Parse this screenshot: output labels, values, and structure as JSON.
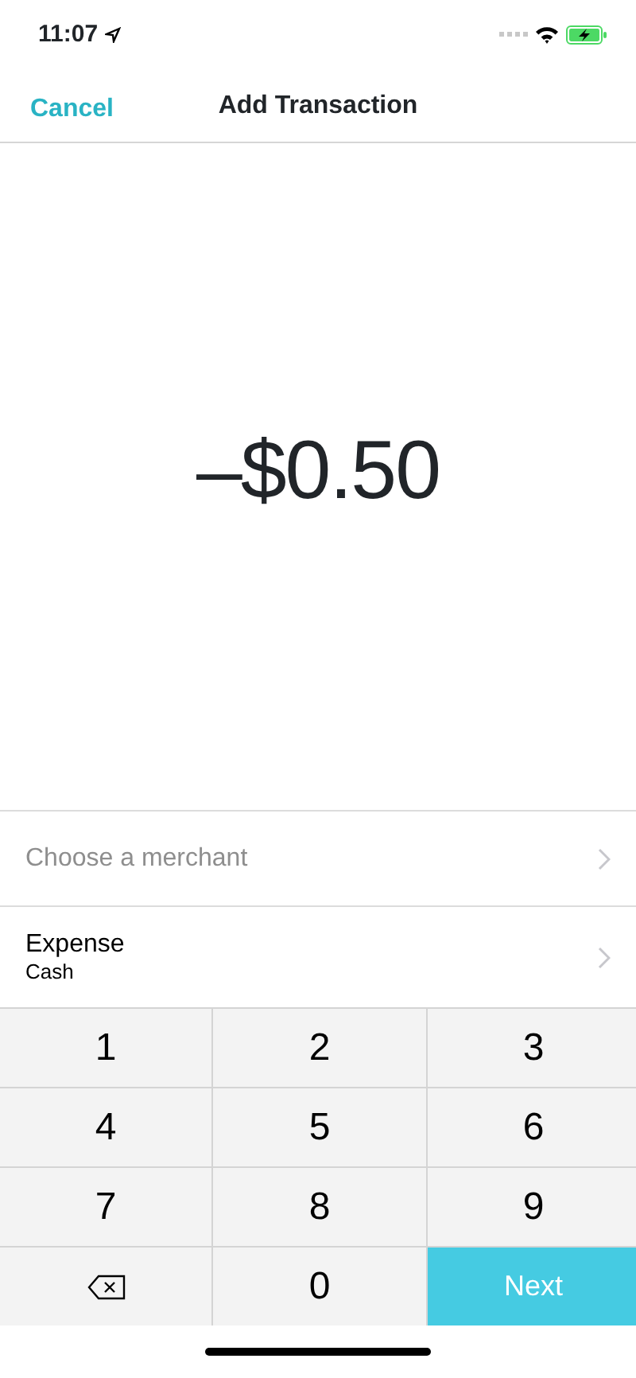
{
  "status_bar": {
    "time": "11:07"
  },
  "nav": {
    "cancel": "Cancel",
    "title": "Add Transaction"
  },
  "amount": "–$0.50",
  "rows": [
    {
      "kind": "placeholder",
      "text": "Choose a merchant"
    },
    {
      "kind": "value",
      "title": "Expense",
      "subtitle": "Cash"
    }
  ],
  "keys": [
    {
      "kind": "digit",
      "label": "1"
    },
    {
      "kind": "digit",
      "label": "2"
    },
    {
      "kind": "digit",
      "label": "3"
    },
    {
      "kind": "digit",
      "label": "4"
    },
    {
      "kind": "digit",
      "label": "5"
    },
    {
      "kind": "digit",
      "label": "6"
    },
    {
      "kind": "digit",
      "label": "7"
    },
    {
      "kind": "digit",
      "label": "8"
    },
    {
      "kind": "digit",
      "label": "9"
    },
    {
      "kind": "delete"
    },
    {
      "kind": "digit",
      "label": "0"
    },
    {
      "kind": "next",
      "label": "Next"
    }
  ]
}
